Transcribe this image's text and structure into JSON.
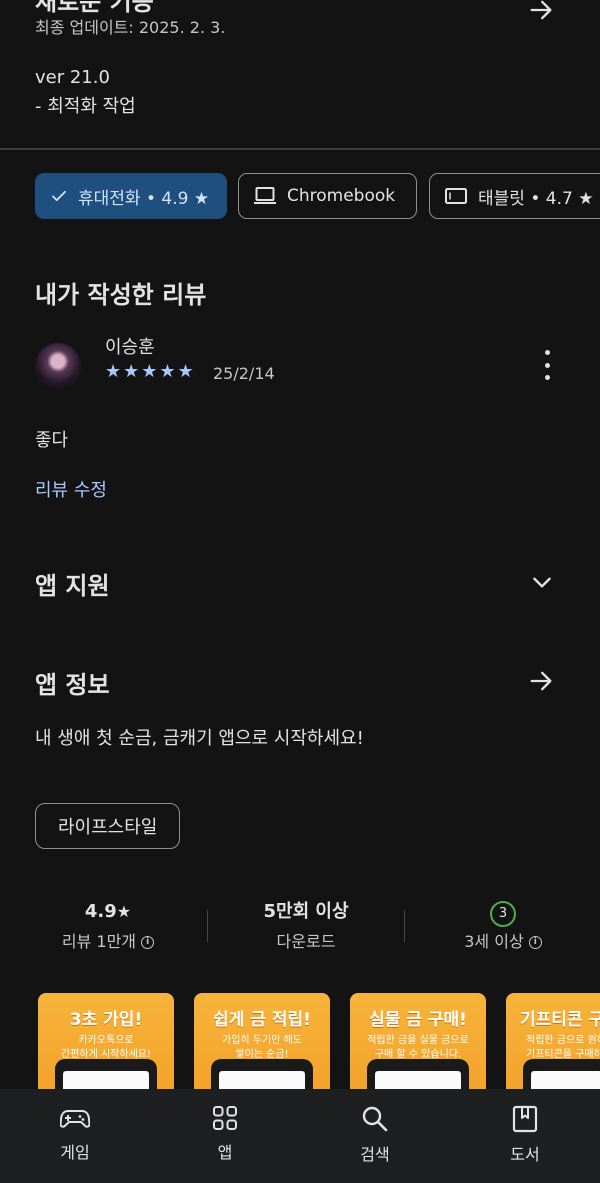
{
  "whats_new": {
    "title": "새로운 기능",
    "updated": "최종 업데이트: 2025. 2. 3.",
    "version": "ver 21.0",
    "note": "- 최적화 작업"
  },
  "device_chips": [
    {
      "label": "휴대전화 • 4.9 ★",
      "selected": true
    },
    {
      "label": "Chromebook",
      "selected": false
    },
    {
      "label": "태블릿 • 4.7 ★",
      "selected": false
    }
  ],
  "my_review": {
    "heading": "내가 작성한 리뷰",
    "reviewer": "이승훈",
    "stars": "★★★★★",
    "rating": 5,
    "date": "25/2/14",
    "text": "좋다",
    "edit_label": "리뷰 수정"
  },
  "app_support": {
    "heading": "앱 지원"
  },
  "app_info": {
    "heading": "앱 정보",
    "description": "내 생애 첫 순금, 금캐기 앱으로 시작하세요!",
    "category_tag": "라이프스타일"
  },
  "stats": {
    "rating_value": "4.9",
    "rating_star": "★",
    "rating_label": "리뷰 1만개",
    "downloads_value": "5만회 이상",
    "downloads_label": "다운로드",
    "age_badge": "3",
    "age_label": "3세 이상"
  },
  "screenshots": [
    {
      "title": "3초 가입!",
      "line1": "카카오톡으로",
      "line2": "간편하게 시작하세요!"
    },
    {
      "title": "쉽게 금 적립!",
      "line1": "가입히 두기만 해도",
      "line2": "쌓이는 순금!"
    },
    {
      "title": "실물 금 구매!",
      "line1": "적립한 금을 실물 금으로",
      "line2": "구매 할 수 있습니다."
    },
    {
      "title": "기프티콘 구",
      "line1": "적립한 금으로 원하",
      "line2": "기프티콘을 구매하"
    }
  ],
  "bottom_nav": [
    {
      "label": "게임",
      "icon": "gamepad-icon"
    },
    {
      "label": "앱",
      "icon": "apps-grid-icon"
    },
    {
      "label": "검색",
      "icon": "search-icon"
    },
    {
      "label": "도서",
      "icon": "book-icon"
    }
  ],
  "colors": {
    "background": "#131314",
    "selected_chip": "#1e4f7f",
    "link": "#a8c7fa",
    "age_badge_ring": "#4caf50",
    "screenshot_bg": "#f3a02a"
  }
}
